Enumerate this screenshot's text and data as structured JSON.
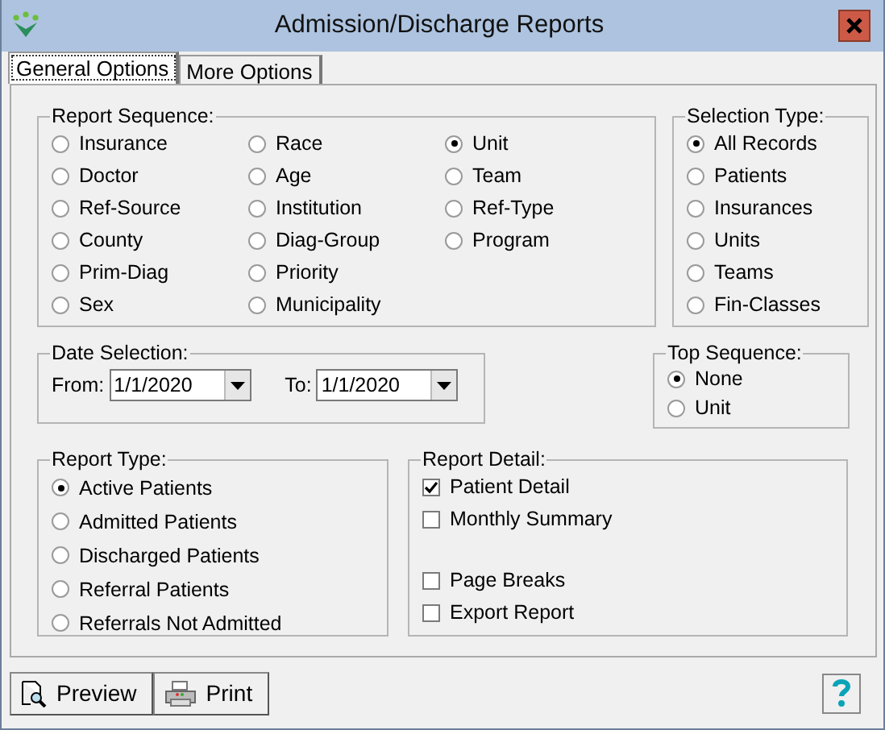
{
  "window": {
    "title": "Admission/Discharge Reports"
  },
  "tabs": [
    {
      "label": "General Options",
      "selected": true
    },
    {
      "label": "More Options",
      "selected": false
    }
  ],
  "report_sequence": {
    "title": "Report Sequence:",
    "columns": [
      [
        {
          "label": "Insurance",
          "selected": false
        },
        {
          "label": "Doctor",
          "selected": false
        },
        {
          "label": "Ref-Source",
          "selected": false
        },
        {
          "label": "County",
          "selected": false
        },
        {
          "label": "Prim-Diag",
          "selected": false
        },
        {
          "label": "Sex",
          "selected": false
        }
      ],
      [
        {
          "label": "Race",
          "selected": false
        },
        {
          "label": "Age",
          "selected": false
        },
        {
          "label": "Institution",
          "selected": false
        },
        {
          "label": "Diag-Group",
          "selected": false
        },
        {
          "label": "Priority",
          "selected": false
        },
        {
          "label": "Municipality",
          "selected": false
        }
      ],
      [
        {
          "label": "Unit",
          "selected": true
        },
        {
          "label": "Team",
          "selected": false
        },
        {
          "label": "Ref-Type",
          "selected": false
        },
        {
          "label": "Program",
          "selected": false
        }
      ]
    ]
  },
  "selection_type": {
    "title": "Selection Type:",
    "options": [
      {
        "label": "All Records",
        "selected": true
      },
      {
        "label": "Patients",
        "selected": false
      },
      {
        "label": "Insurances",
        "selected": false
      },
      {
        "label": "Units",
        "selected": false
      },
      {
        "label": "Teams",
        "selected": false
      },
      {
        "label": "Fin-Classes",
        "selected": false
      }
    ]
  },
  "date_selection": {
    "title": "Date Selection:",
    "from_label": "From:",
    "from_value": "1/1/2020",
    "to_label": "To:",
    "to_value": "1/1/2020"
  },
  "top_sequence": {
    "title": "Top Sequence:",
    "options": [
      {
        "label": "None",
        "selected": true
      },
      {
        "label": "Unit",
        "selected": false
      }
    ]
  },
  "report_type": {
    "title": "Report Type:",
    "options": [
      {
        "label": "Active Patients",
        "selected": true
      },
      {
        "label": "Admitted Patients",
        "selected": false
      },
      {
        "label": "Discharged Patients",
        "selected": false
      },
      {
        "label": "Referral Patients",
        "selected": false
      },
      {
        "label": "Referrals Not Admitted",
        "selected": false
      }
    ]
  },
  "report_detail": {
    "title": "Report Detail:",
    "options": [
      {
        "label": "Patient Detail",
        "checked": true
      },
      {
        "label": "Monthly Summary",
        "checked": false
      }
    ],
    "output_options": [
      {
        "label": "Page Breaks",
        "checked": false
      },
      {
        "label": "Export Report",
        "checked": false
      }
    ]
  },
  "buttons": [
    {
      "label": "Preview",
      "kind": "preview"
    },
    {
      "label": "Print",
      "kind": "print"
    }
  ]
}
